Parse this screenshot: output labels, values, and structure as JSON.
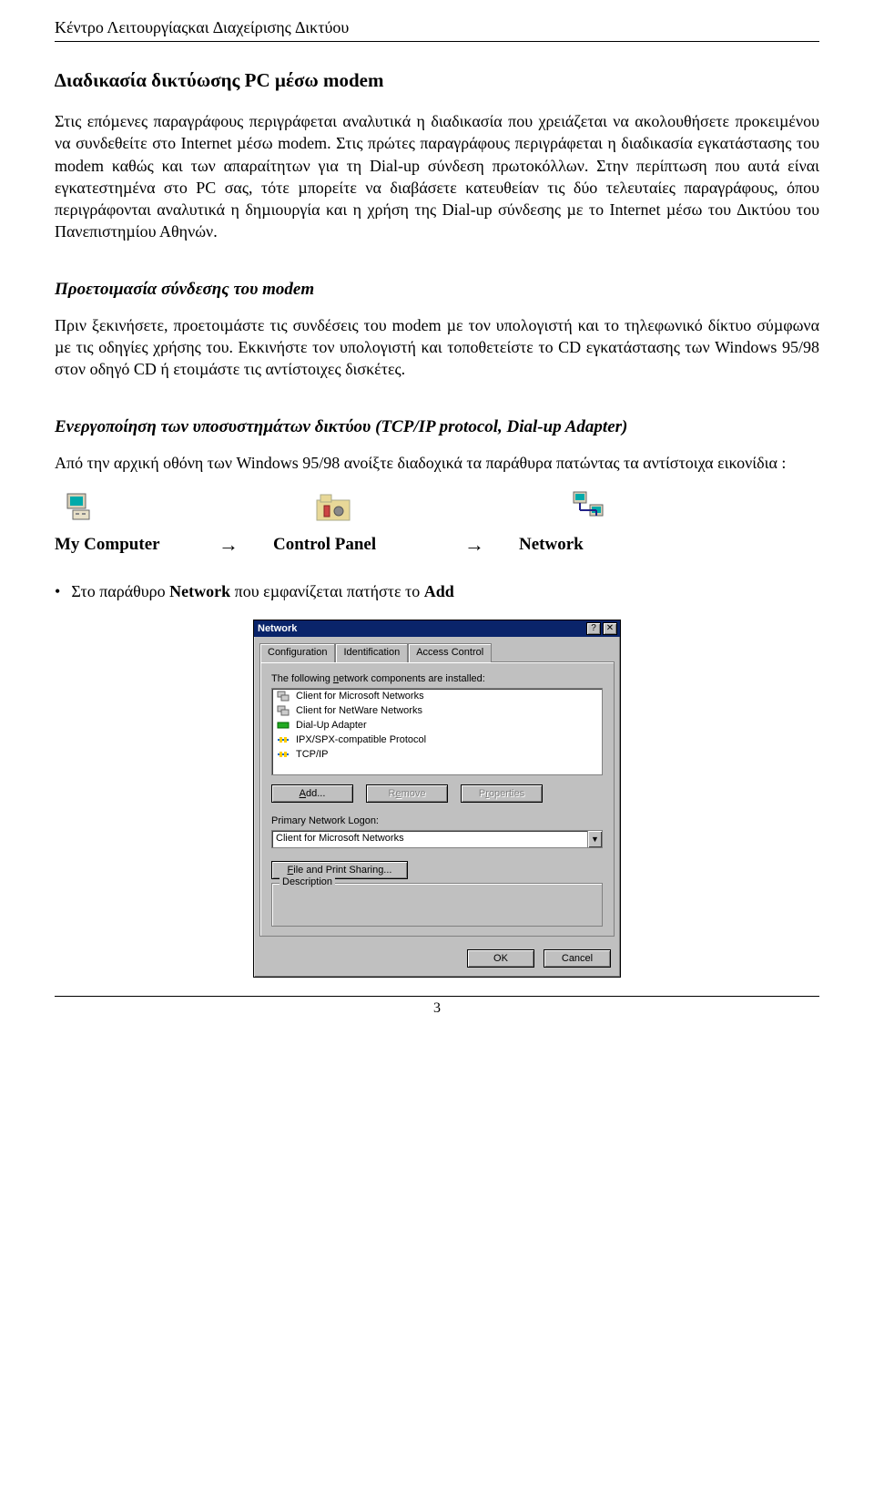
{
  "header": "Κέντρο Λειτουργίαςκαι ∆ιαχείρισης ∆ικτύου",
  "title": "∆ιαδικασία δικτύωσης PC µέσω modem",
  "intro": "Στις επόµενες παραγράφους περιγράφεται αναλυτικά η διαδικασία που χρειάζεται να ακολουθήσετε προκειµένου να συνδεθείτε στο Internet µέσω modem. Στις πρώτες παραγράφους περιγράφεται η διαδικασία εγκατάστασης του modem καθώς και των απαραίτητων για τη Dial-up σύνδεση πρωτοκόλλων. Στην περίπτωση που αυτά είναι εγκατεστηµένα στο PC σας, τότε µπορείτε να διαβάσετε κατευθείαν τις δύο τελευταίες παραγράφους, όπου περιγράφονται αναλυτικά η δηµιουργία και η χρήση της Dial-up σύνδεσης µε το Internet µέσω του ∆ικτύου του Πανεπιστηµίου Αθηνών.",
  "section1": {
    "heading": "Προετοιµασία σύνδεσης του modem",
    "text": "Πριν ξεκινήσετε, προετοιµάστε τις συνδέσεις του modem µε τον υπολογιστή και το τηλεφωνικό δίκτυο σύµφωνα µε τις οδηγίες χρήσης του. Εκκινήστε τον υπολογιστή και τοποθετείστε το CD εγκατάστασης των Windows 95/98 στον οδηγό CD ή ετοιµάστε τις αντίστοιχες δισκέτες."
  },
  "section2": {
    "heading": "Ενεργοποίηση των υποσυστηµάτων δικτύου (TCP/IP protocol, Dial-up Adapter)",
    "text": "Από την αρχική οθόνη των Windows 95/98 ανοίξτε διαδοχικά τα παράθυρα πατώντας τα αντίστοιχα εικονίδια :",
    "icons": {
      "my_computer": "My Computer",
      "control_panel": "Control Panel",
      "network": "Network"
    },
    "arrow": "→",
    "bullet_pre": "Στο παράθυρο ",
    "bullet_bold1": "Network",
    "bullet_mid": "  που εµφανίζεται πατήστε το ",
    "bullet_bold2": "Add"
  },
  "dialog": {
    "title": "Network",
    "help_btn": "?",
    "close_btn": "✕",
    "tabs": [
      "Configuration",
      "Identification",
      "Access Control"
    ],
    "list_label_pre": "The following ",
    "list_label_u": "n",
    "list_label_post": "etwork components are installed:",
    "components": [
      "Client for Microsoft Networks",
      "Client for NetWare Networks",
      "Dial-Up Adapter",
      "IPX/SPX-compatible Protocol",
      "TCP/IP"
    ],
    "buttons": {
      "add": "Add...",
      "remove": "Remove",
      "properties": "Properties"
    },
    "logon_label": "Primary Network Logon:",
    "logon_value": "Client for Microsoft Networks",
    "file_print": "File and Print Sharing...",
    "description": "Description",
    "ok": "OK",
    "cancel": "Cancel"
  },
  "page_number": "3"
}
